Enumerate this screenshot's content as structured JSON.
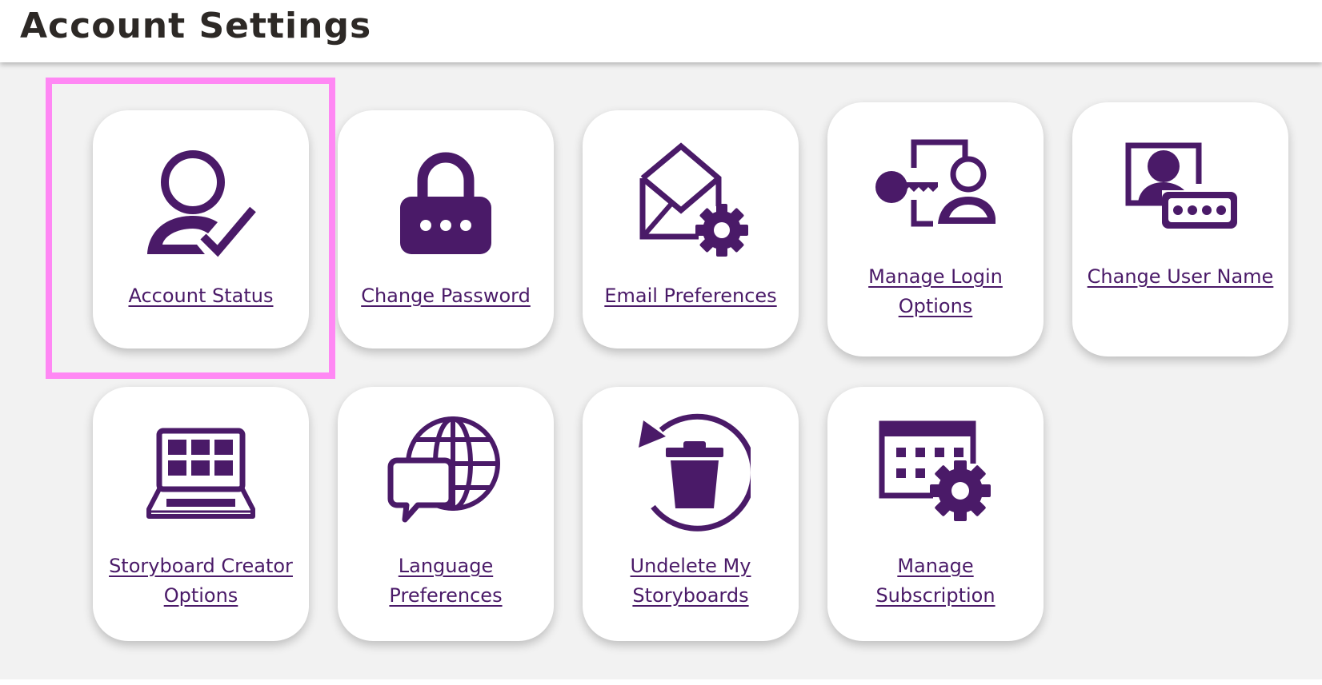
{
  "header": {
    "title": "Account Settings"
  },
  "colors": {
    "accent": "#4a1a68",
    "highlight": "#ff88f4",
    "background": "#f2f2f2",
    "title": "#2d2926"
  },
  "cards": [
    {
      "label": "Account Status",
      "icon": "user-check-icon"
    },
    {
      "label": "Change Password",
      "icon": "lock-icon"
    },
    {
      "label": "Email Preferences",
      "icon": "envelope-gear-icon"
    },
    {
      "label": "Manage Login Options",
      "icon": "key-user-icon"
    },
    {
      "label": "Change User Name",
      "icon": "user-id-icon"
    },
    {
      "label": "Storyboard Creator Options",
      "icon": "laptop-grid-icon"
    },
    {
      "label": "Language Preferences",
      "icon": "globe-chat-icon"
    },
    {
      "label": "Undelete My Storyboards",
      "icon": "trash-restore-icon"
    },
    {
      "label": "Manage Subscription",
      "icon": "calendar-gear-icon"
    }
  ],
  "selected": "Account Status"
}
